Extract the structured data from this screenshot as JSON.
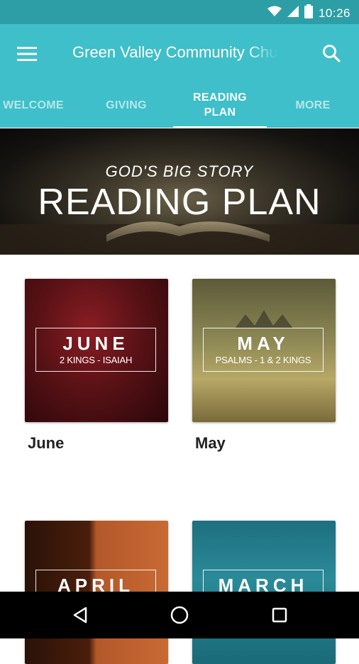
{
  "status_bar": {
    "time": "10:26"
  },
  "app_bar": {
    "title": "Green Valley Community Church"
  },
  "tabs": [
    {
      "label": "WELCOME"
    },
    {
      "label": "GIVING"
    },
    {
      "label": "READING PLAN"
    },
    {
      "label": "MORE"
    }
  ],
  "hero": {
    "subtitle": "GOD'S BIG STORY",
    "title": "READING PLAN"
  },
  "cards": [
    {
      "month": "JUNE",
      "books": "2 KINGS - ISAIAH",
      "caption": "June"
    },
    {
      "month": "MAY",
      "books": "PSALMS - 1 & 2 KINGS",
      "caption": "May"
    },
    {
      "month": "APRIL",
      "books": "",
      "caption": ""
    },
    {
      "month": "MARCH",
      "books": "",
      "caption": ""
    }
  ],
  "colors": {
    "status_bar": "#2e9ea6",
    "app_bar": "#3ebfc9",
    "nav_bar": "#000000"
  }
}
